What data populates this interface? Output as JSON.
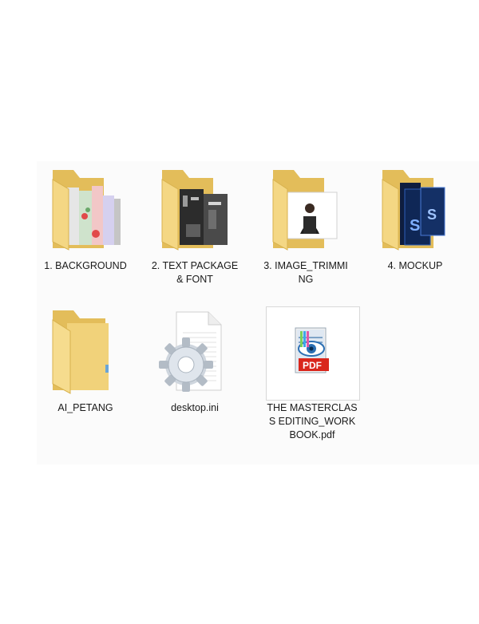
{
  "items": [
    {
      "label": "1. BACKGROUND",
      "icon": "folder-icon"
    },
    {
      "label": "2. TEXT PACKAGE & FONT",
      "icon": "folder-icon"
    },
    {
      "label": "3. IMAGE_TRIMMING",
      "icon": "folder-icon"
    },
    {
      "label": "4. MOCKUP",
      "icon": "folder-icon"
    },
    {
      "label": "AI_PETANG",
      "icon": "folder-icon"
    },
    {
      "label": "desktop.ini",
      "icon": "settings-file-icon"
    },
    {
      "label": "THE MASTERCLASS EDITING_WORKBOOK.pdf",
      "icon": "pdf-file-icon"
    }
  ],
  "colors": {
    "folder_back": "#e9c96c",
    "folder_front": "#f6dc8e",
    "pdf_red": "#d9261c"
  }
}
